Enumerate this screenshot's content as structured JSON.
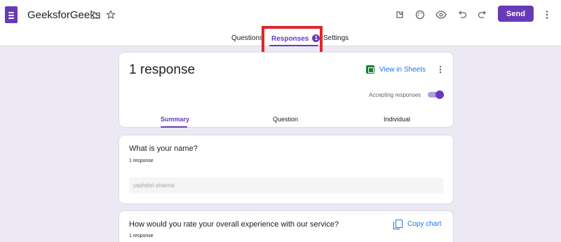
{
  "app": {
    "title": "GeeksforGeeks",
    "icons": [
      "forms-doc-icon",
      "folder-icon",
      "star-icon",
      "customize-theme-icon",
      "palette-icon",
      "preview-eye-icon",
      "undo-icon",
      "redo-icon",
      "more-vert-icon"
    ],
    "send_label": "Send"
  },
  "tabs": [
    {
      "label": "Questions",
      "active": false
    },
    {
      "label": "Responses",
      "active": true,
      "badge": "1"
    },
    {
      "label": "Settings",
      "active": false
    }
  ],
  "summary_card": {
    "count_label": "1 response",
    "view_in_sheets": "View in Sheets",
    "accepting_label": "Accepting responses",
    "accepting": true,
    "subtabs": [
      "Summary",
      "Question",
      "Individual"
    ],
    "active_subtab": "Summary"
  },
  "questions": [
    {
      "title": "What is your name?",
      "count": "1 response",
      "answer": "yashshri sharma"
    },
    {
      "title": "How would you rate your overall experience with our service?",
      "count": "1 response",
      "copy_chart": "Copy chart"
    }
  ],
  "colors": {
    "accent": "#673ab7",
    "highlight": "#e0262c",
    "link": "#1a73e8",
    "background": "#ece9f5"
  }
}
